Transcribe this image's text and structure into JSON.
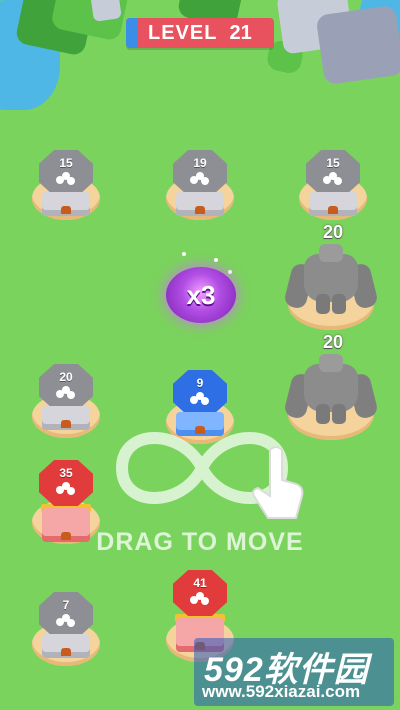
{
  "level": {
    "label": "LEVEL",
    "number": "21"
  },
  "towers": [
    {
      "id": "tower-gray-15-left",
      "team": "gray",
      "count": "15"
    },
    {
      "id": "tower-gray-19",
      "team": "gray",
      "count": "19"
    },
    {
      "id": "tower-gray-15-right",
      "team": "gray",
      "count": "15"
    },
    {
      "id": "tower-gray-20",
      "team": "gray",
      "count": "20"
    },
    {
      "id": "tower-blue-9",
      "team": "blue",
      "count": "9"
    },
    {
      "id": "tower-red-35",
      "team": "red",
      "count": "35"
    },
    {
      "id": "tower-gray-7",
      "team": "gray",
      "count": "7"
    },
    {
      "id": "tower-red-41",
      "team": "red",
      "count": "41"
    }
  ],
  "giants": [
    {
      "id": "giant-top",
      "count": "20"
    },
    {
      "id": "giant-bottom",
      "count": "20"
    }
  ],
  "multiplier": {
    "label": "x3"
  },
  "hint": {
    "text": "DRAG TO MOVE"
  },
  "watermark": {
    "brand": "592软件园",
    "url": "www.592xiazai.com"
  },
  "colors": {
    "grass": "#7ad35c",
    "player_blue": "#2f6fe6",
    "enemy_red": "#e23b3b",
    "neutral_gray": "#8e8e95",
    "multiplier_purple": "#b24ee4",
    "level_badge": "#e8525f"
  }
}
